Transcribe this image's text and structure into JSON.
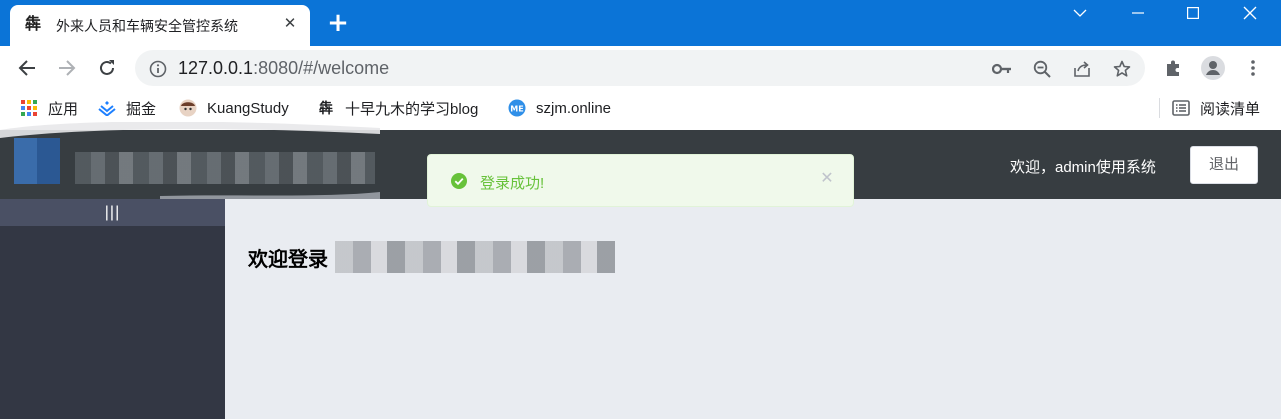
{
  "browser": {
    "tab": {
      "title": "外来人员和车辆安全管控系统",
      "favicon": "犇",
      "close": "✕"
    },
    "new_tab": "+",
    "url": {
      "host": "127.0.0.1",
      "rest": ":8080/#/welcome"
    },
    "bookmarks": [
      {
        "label": "应用",
        "icon": "apps-grid-icon"
      },
      {
        "label": "掘金",
        "icon": "juejin-icon"
      },
      {
        "label": "KuangStudy",
        "icon": "kuangstudy-avatar-icon"
      },
      {
        "label": "十早九木的学习blog",
        "icon": "blog-favicon-icon"
      },
      {
        "label": "szjm.online",
        "icon": "szjm-icon"
      }
    ],
    "reading_list": "阅读清单"
  },
  "app": {
    "header": {
      "welcome_text": "欢迎，admin使用系统",
      "logout_label": "退出"
    },
    "sidebar": {
      "collapse_label": "|||"
    },
    "main": {
      "heading_prefix": "欢迎登录"
    },
    "toast": {
      "message": "登录成功!",
      "type": "success"
    }
  },
  "colors": {
    "chrome_frame": "#0b74d7",
    "header_bg": "#373d41",
    "sidebar_bg": "#333744",
    "collapse_bg": "#4a5064",
    "main_bg": "#e9ecf1",
    "toast_success": "#67c23a"
  }
}
